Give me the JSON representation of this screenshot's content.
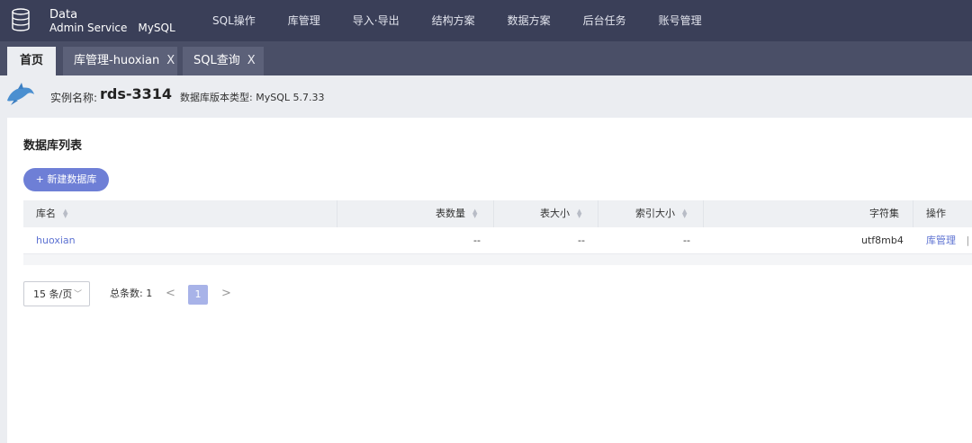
{
  "app": {
    "logo_line1": "Data",
    "logo_line2": "Admin Service",
    "db_type": "MySQL"
  },
  "nav": {
    "items": [
      "SQL操作",
      "库管理",
      "导入·导出",
      "结构方案",
      "数据方案",
      "后台任务",
      "账号管理"
    ]
  },
  "tabs": [
    {
      "label": "首页",
      "active": true
    },
    {
      "label": "库管理-huoxian",
      "closable": true
    },
    {
      "label": "SQL查询",
      "closable": true
    }
  ],
  "tab_close_glyph": "X",
  "instance": {
    "name_label": "实例名称:",
    "name": "rds-3314",
    "version_label": "数据库版本类型:",
    "version": "MySQL 5.7.33"
  },
  "list": {
    "title": "数据库列表",
    "new_button": "新建数据库",
    "new_button_icon": "+",
    "columns": [
      "库名",
      "表数量",
      "表大小",
      "索引大小",
      "字符集",
      "操作"
    ],
    "rows": [
      {
        "name": "huoxian",
        "table_count": "--",
        "table_size": "--",
        "index_size": "--",
        "charset": "utf8mb4",
        "action": "库管理",
        "action_sep": "|"
      }
    ]
  },
  "pagination": {
    "page_size": "15 条/页",
    "total_label": "总条数:",
    "total": "1",
    "current_page": "1",
    "prev_glyph": "<",
    "next_glyph": ">"
  },
  "colors": {
    "nav_bg": "#3a3f58",
    "accent": "#6e7fd6",
    "link": "#5d72d2"
  }
}
